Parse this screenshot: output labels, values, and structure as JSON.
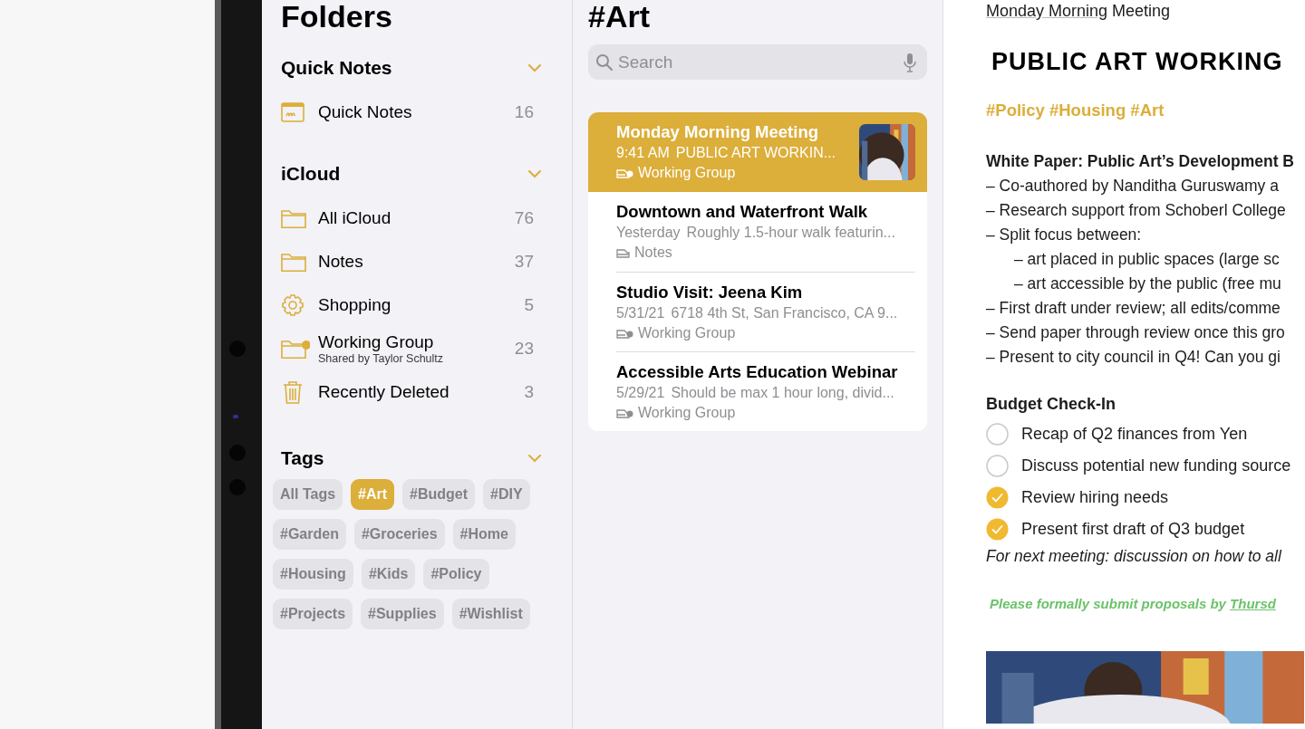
{
  "sidebar": {
    "title": "Folders",
    "sections": [
      {
        "title": "Quick Notes",
        "expanded": true,
        "items": [
          {
            "kind": "quicknote",
            "label": "Quick Notes",
            "count": "16"
          }
        ]
      },
      {
        "title": "iCloud",
        "expanded": true,
        "items": [
          {
            "kind": "folder",
            "label": "All iCloud",
            "count": "76"
          },
          {
            "kind": "folder",
            "label": "Notes",
            "count": "37"
          },
          {
            "kind": "smart",
            "label": "Shopping",
            "count": "5"
          },
          {
            "kind": "shared",
            "label": "Working Group",
            "subtitle": "Shared by Taylor Schultz",
            "count": "23"
          },
          {
            "kind": "trash",
            "label": "Recently Deleted",
            "count": "3"
          }
        ]
      }
    ],
    "tags": {
      "title": "Tags",
      "expanded": true,
      "rows": [
        [
          {
            "label": "All Tags",
            "selected": false
          },
          {
            "label": "#Art",
            "selected": true
          },
          {
            "label": "#Budget",
            "selected": false
          },
          {
            "label": "#DIY",
            "selected": false
          }
        ],
        [
          {
            "label": "#Garden",
            "selected": false
          },
          {
            "label": "#Groceries",
            "selected": false
          },
          {
            "label": "#Home",
            "selected": false
          }
        ],
        [
          {
            "label": "#Housing",
            "selected": false
          },
          {
            "label": "#Kids",
            "selected": false
          },
          {
            "label": "#Policy",
            "selected": false
          }
        ],
        [
          {
            "label": "#Projects",
            "selected": false
          },
          {
            "label": "#Supplies",
            "selected": false
          },
          {
            "label": "#Wishlist",
            "selected": false
          }
        ]
      ]
    }
  },
  "list": {
    "title": "#Art",
    "search": {
      "placeholder": "Search"
    },
    "notes": [
      {
        "title": "Monday Morning Meeting",
        "date": "9:41 AM",
        "preview": "PUBLIC ART WORKIN...",
        "kind": "shared",
        "folder": "Working Group",
        "selected": true
      },
      {
        "title": "Downtown and Waterfront Walk",
        "date": "Yesterday",
        "preview": "Roughly 1.5-hour walk featurin...",
        "kind": "folder",
        "folder": "Notes",
        "selected": false
      },
      {
        "title": "Studio Visit: Jeena Kim",
        "date": "5/31/21",
        "preview": "6718 4th St, San Francisco, CA 9...",
        "kind": "shared",
        "folder": "Working Group",
        "selected": false
      },
      {
        "title": "Accessible Arts Education Webinar",
        "date": "5/29/21",
        "preview": "Should be max 1 hour long, divid...",
        "kind": "shared",
        "folder": "Working Group",
        "selected": false
      }
    ]
  },
  "note": {
    "link": {
      "underlined": "Monday Morning",
      "rest": " Meeting"
    },
    "heading": "PUBLIC ART WORKING",
    "tags": "#Policy #Housing #Art",
    "blocks": [
      {
        "kind": "heading",
        "text": "White Paper: Public Art’s Development B"
      },
      {
        "kind": "line",
        "text": "– Co-authored by Nanditha Guruswamy a"
      },
      {
        "kind": "line",
        "text": "– Research support from Schoberl College"
      },
      {
        "kind": "line",
        "text": "– Split focus between:"
      },
      {
        "kind": "subline",
        "text": "– art placed in public spaces (large sc"
      },
      {
        "kind": "subline",
        "text": "– art accessible by the public (free mu"
      },
      {
        "kind": "line",
        "text": "– First draft under review; all edits/comme"
      },
      {
        "kind": "line",
        "text": "– Send paper through review once this gro"
      },
      {
        "kind": "line",
        "text": "– Present to city council in Q4! Can you gi"
      }
    ],
    "checklist_title": "Budget Check-In",
    "checklist": [
      {
        "text": "Recap of Q2 finances from Yen",
        "checked": false
      },
      {
        "text": "Discuss potential new funding source",
        "checked": false
      },
      {
        "text": "Review hiring needs",
        "checked": true
      },
      {
        "text": "Present first draft of Q3 budget",
        "checked": true
      }
    ],
    "italic_note": "For next meeting: discussion on how to all",
    "handwritten": {
      "text": "Please formally submit proposals by ",
      "underlined": "Thursd"
    }
  }
}
